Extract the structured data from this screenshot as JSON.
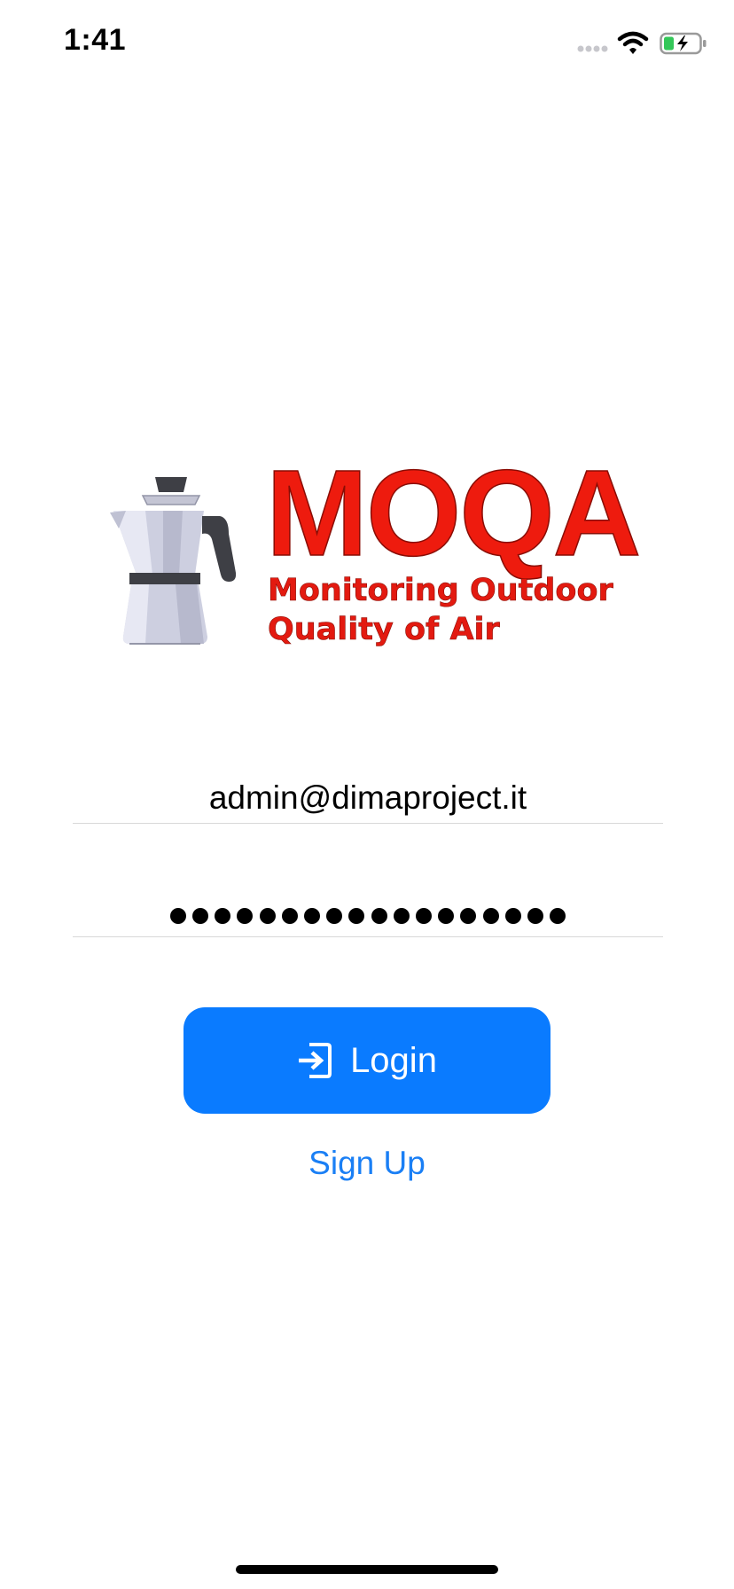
{
  "status_bar": {
    "time": "1:41",
    "icons": [
      "cellular-signal-icon",
      "wifi-icon",
      "battery-charging-icon"
    ]
  },
  "logo": {
    "title": "MOQA",
    "subtitle_line1": "Monitoring Outdoor",
    "subtitle_line2": "Quality of Air",
    "icon": "moka-pot-icon",
    "colors": {
      "title": "#ee1b0e",
      "outline": "#8a0d05"
    }
  },
  "form": {
    "email_value": "admin@dimaproject.it",
    "password_mask_count": 18
  },
  "buttons": {
    "login_label": "Login",
    "login_icon": "login-icon",
    "signup_label": "Sign Up"
  },
  "colors": {
    "accent": "#0a7bff",
    "link": "#1a7ff5",
    "divider": "#d8d8d8"
  }
}
